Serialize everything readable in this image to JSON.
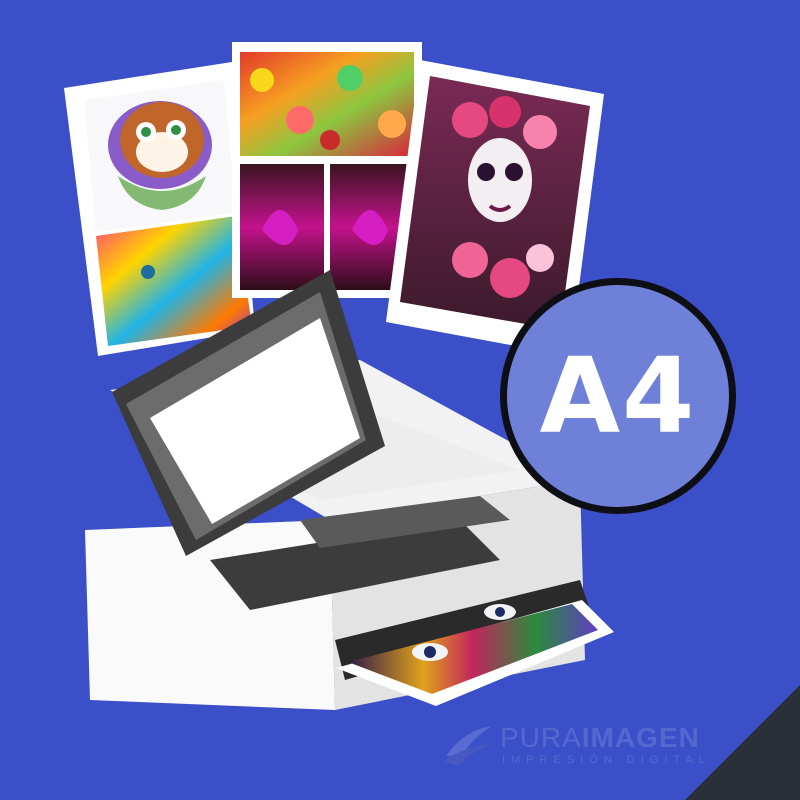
{
  "badge": {
    "label": "A4"
  },
  "logo": {
    "word_light": "PURA",
    "word_bold": "IMAGEN",
    "tagline": "IMPRESIÓN DIGITAL"
  },
  "colors": {
    "background": "#3a4fc8",
    "badge_fill": "#6e80d8",
    "badge_border": "#0e0f14",
    "printer_body": "#f2f2f2",
    "printer_dark": "#3c3c3c",
    "corner": "#2a2f37"
  },
  "icons": [
    "printer-icon",
    "logo-mark-icon"
  ]
}
